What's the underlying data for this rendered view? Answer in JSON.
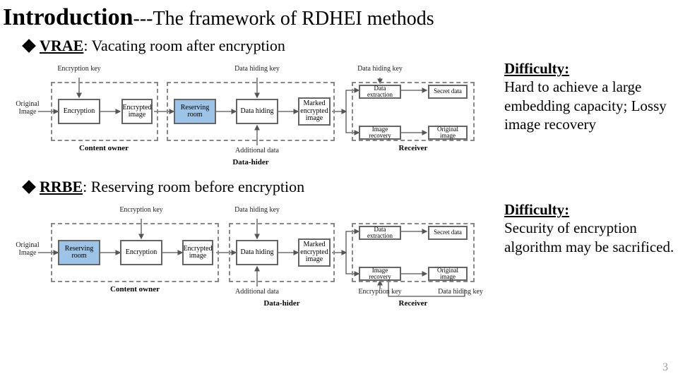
{
  "title": {
    "lead": "Introduction",
    "dashes": "---",
    "rest": "The framework of RDHEI methods"
  },
  "vrae": {
    "acronym": "VRAE",
    "label": ": Vacating room after encryption",
    "difficulty_label": "Difficulty:",
    "difficulty_body": "Hard to achieve a large embedding capacity; Lossy image recovery"
  },
  "rrbe": {
    "acronym": "RRBE",
    "label": ": Reserving room before encryption",
    "difficulty_label": "Difficulty:",
    "difficulty_body": "Security of encryption algorithm may be sacrificed."
  },
  "common": {
    "original_image": "Original Image",
    "encryption": "Encryption",
    "encrypted_image": "Encrypted image",
    "reserving_room": "Reserving room",
    "data_hiding": "Data hiding",
    "marked_enc": "Marked encrypted image",
    "data_extraction": "Data extraction",
    "image_recovery": "Image recovery",
    "secret_data": "Secret data",
    "original_image2": "Original image",
    "encryption_key": "Encryption key",
    "data_hiding_key": "Data hiding key",
    "additional_data": "Additional data",
    "role_owner": "Content owner",
    "role_hider": "Data-hider",
    "role_receiver": "Receiver"
  },
  "slide_number": "3"
}
